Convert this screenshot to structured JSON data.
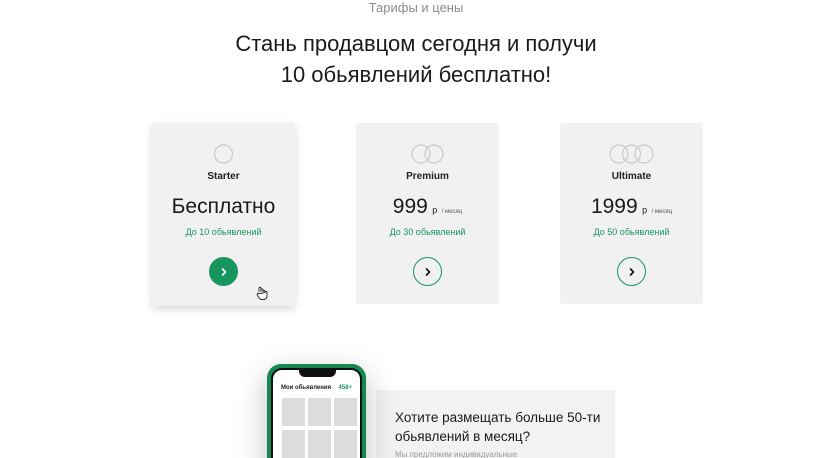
{
  "section_label": "Тарифы и цены",
  "headline": {
    "line1": "Стань продавцом сегодня и получи",
    "line2": "10 обьявлений бесплатно!"
  },
  "plans": [
    {
      "name": "Starter",
      "price": "Бесплатно",
      "unit": "",
      "period": "",
      "limit": "До 10 обьявлений",
      "rings": 1,
      "selected": true
    },
    {
      "name": "Premium",
      "price": "999",
      "unit": "р",
      "period": "/ месяц",
      "limit": "До 30 обьявлений",
      "rings": 2,
      "selected": false
    },
    {
      "name": "Ultimate",
      "price": "1999",
      "unit": "р",
      "period": "/ месяц",
      "limit": "До 50 обьявлений",
      "rings": 3,
      "selected": false
    }
  ],
  "phone": {
    "title": "Мои обьявления",
    "badge": "458+"
  },
  "promo": {
    "title": "Хотите размещать больше 50-ти обьявлений в месяц?",
    "subtitle": "Мы предложим индивидуальные"
  },
  "colors": {
    "accent": "#16955f",
    "card_bg": "#f1f1f1",
    "ring": "#c8c8c8"
  }
}
